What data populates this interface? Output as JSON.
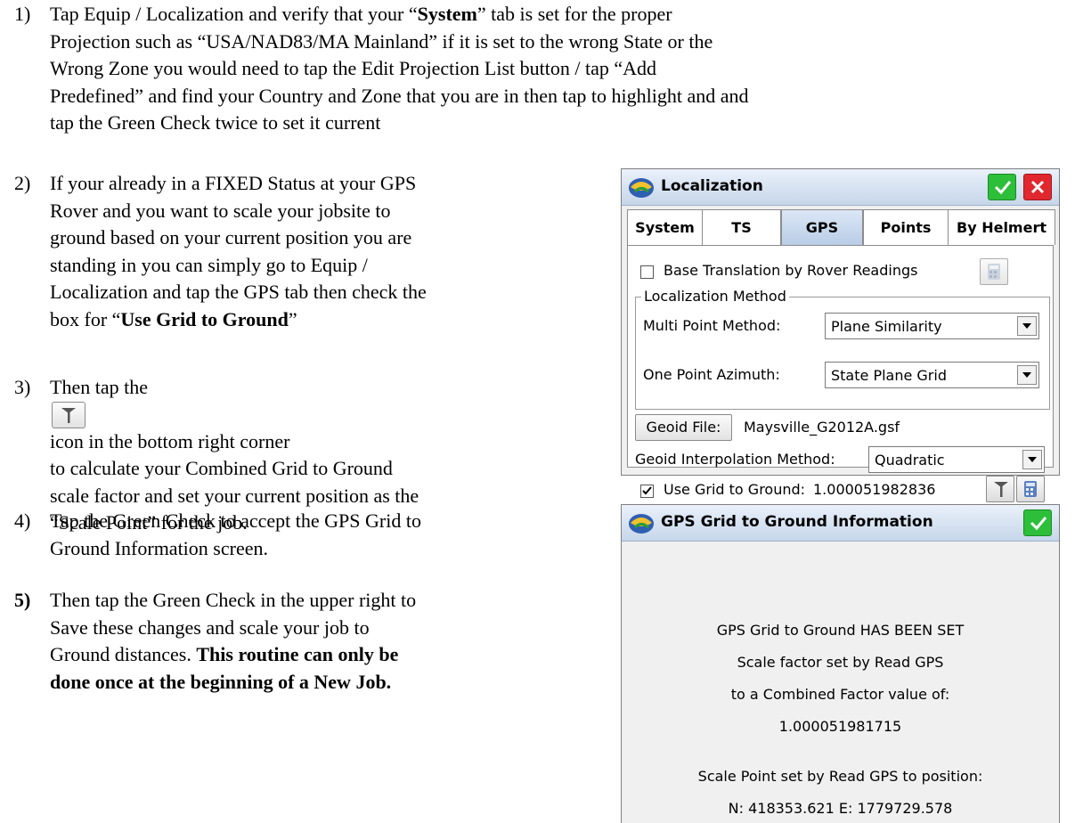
{
  "steps": [
    {
      "num": "1)",
      "lines": [
        "Tap Equip / Localization and verify that your “System” tab is set for the proper",
        "Projection such as “USA/NAD83/MA Mainland” if it is set to the wrong State or the",
        "Wrong Zone you would need to tap the Edit Projection List button / tap “Add",
        "Predefined” and find your Country and Zone that you are in then tap to highlight and and",
        "tap the Green Check twice to set it current"
      ]
    },
    {
      "num": "2)",
      "lines": [
        "If your already in a FIXED Status at your GPS",
        "Rover and you want to scale your jobsite to",
        "ground based on your current position you are",
        "standing in you can simply go to Equip /",
        "Localization and tap the GPS tab then check the",
        "box for “Use Grid to Ground”"
      ]
    },
    {
      "num": "3)",
      "lines": [
        "Then tap the",
        "icon in the bottom right corner",
        "to calculate your Combined Grid to Ground",
        "scale factor and set your current position as the",
        "“Scale Point” for the job."
      ]
    },
    {
      "num": "4)",
      "lines": [
        "Tap the Green Check to accept the GPS Grid to",
        "Ground Information screen."
      ]
    },
    {
      "num": "5)",
      "lines": [
        "Then tap the Green Check in the upper right to",
        "Save these changes and scale your job to",
        "Ground distances. This routine can only be",
        "done once at the beginning of a New Job."
      ]
    }
  ],
  "localization": {
    "title": "Localization",
    "tabs": [
      "System",
      "TS",
      "GPS",
      "Points",
      "By Helmert"
    ],
    "active_tab": "GPS",
    "base_translation_label": "Base Translation by Rover Readings",
    "method_group_label": "Localization Method",
    "multi_point_label": "Multi Point Method:",
    "multi_point_value": "Plane Similarity",
    "one_point_label": "One Point Azimuth:",
    "one_point_value": "State Plane Grid",
    "geoid_file_button": "Geoid File:",
    "geoid_file_value": "Maysville_G2012A.gsf",
    "geoid_interp_label": "Geoid Interpolation Method:",
    "geoid_interp_value": "Quadratic",
    "use_grid_label": "Use Grid to Ground:",
    "use_grid_value": "1.000051982836"
  },
  "gps_info": {
    "title": "GPS Grid to Ground Information",
    "lines": [
      "GPS Grid to Ground HAS BEEN SET",
      "Scale factor set by Read GPS",
      "to a Combined Factor value of:",
      "1.000051981715",
      "",
      "Scale Point set by Read GPS to position:",
      "N: 418353.621 E: 1779729.578"
    ]
  },
  "colors": {
    "ok_green": "#2dbf3a",
    "cancel_red": "#e0282e",
    "title_blue": "#c6d6ea"
  }
}
